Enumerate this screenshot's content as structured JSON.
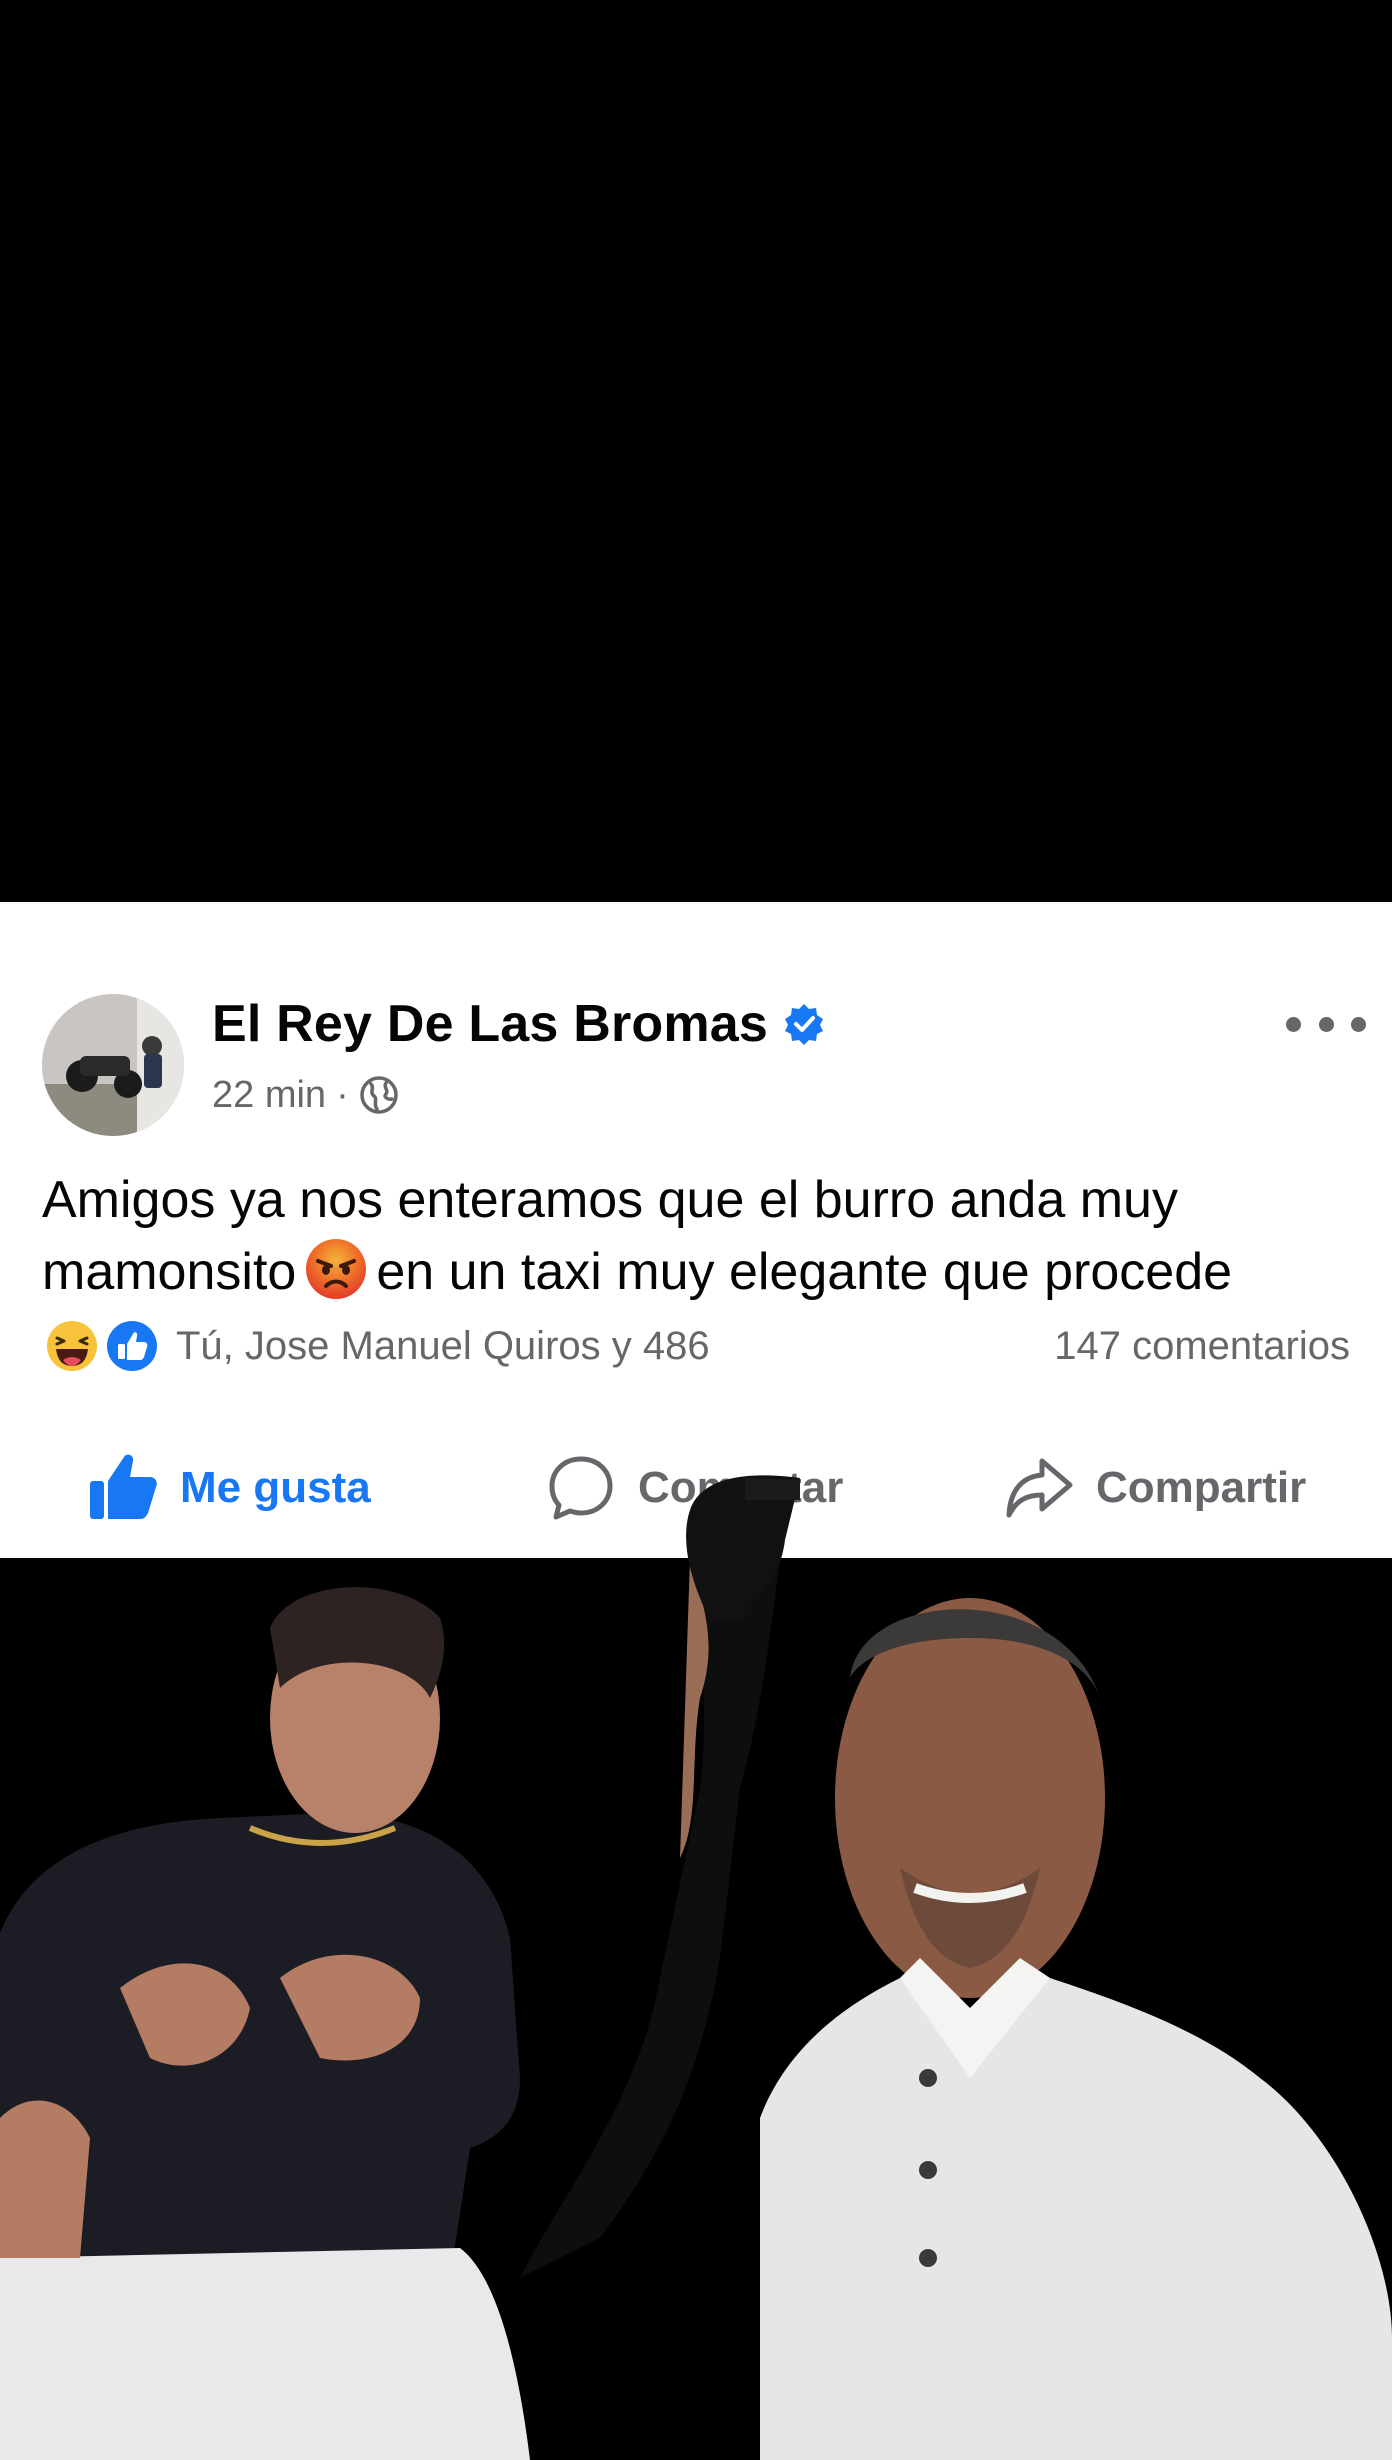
{
  "post": {
    "author": "El Rey De Las Bromas",
    "time": "22 min",
    "separator": "·",
    "text_line1": "Amigos ya nos enteramos que el burro anda muy",
    "text_line2_before": "mamonsito",
    "text_line2_after": "en un taxi muy elegante que procede",
    "reaction_names": "Tú, Jose Manuel Quiros y 486",
    "comment_count": "147 comentarios"
  },
  "actions": {
    "like": "Me gusta",
    "comment": "Comentar",
    "share": "Compartir"
  },
  "icons": {
    "avatar": "avatar",
    "verified": "verified-badge-icon",
    "audience": "globe-icon",
    "more": "more-options-icon",
    "angry_emoji": "angry-face-emoji",
    "haha_reaction": "haha-reaction-icon",
    "like_reaction": "like-reaction-icon",
    "like_action": "thumbs-up-icon",
    "comment_action": "comment-bubble-icon",
    "share_action": "share-arrow-icon"
  },
  "colors": {
    "brand_blue": "#1877f2",
    "text_primary": "#050505",
    "text_secondary": "#65676b",
    "card_background": "#ffffff",
    "page_background": "#000000"
  }
}
